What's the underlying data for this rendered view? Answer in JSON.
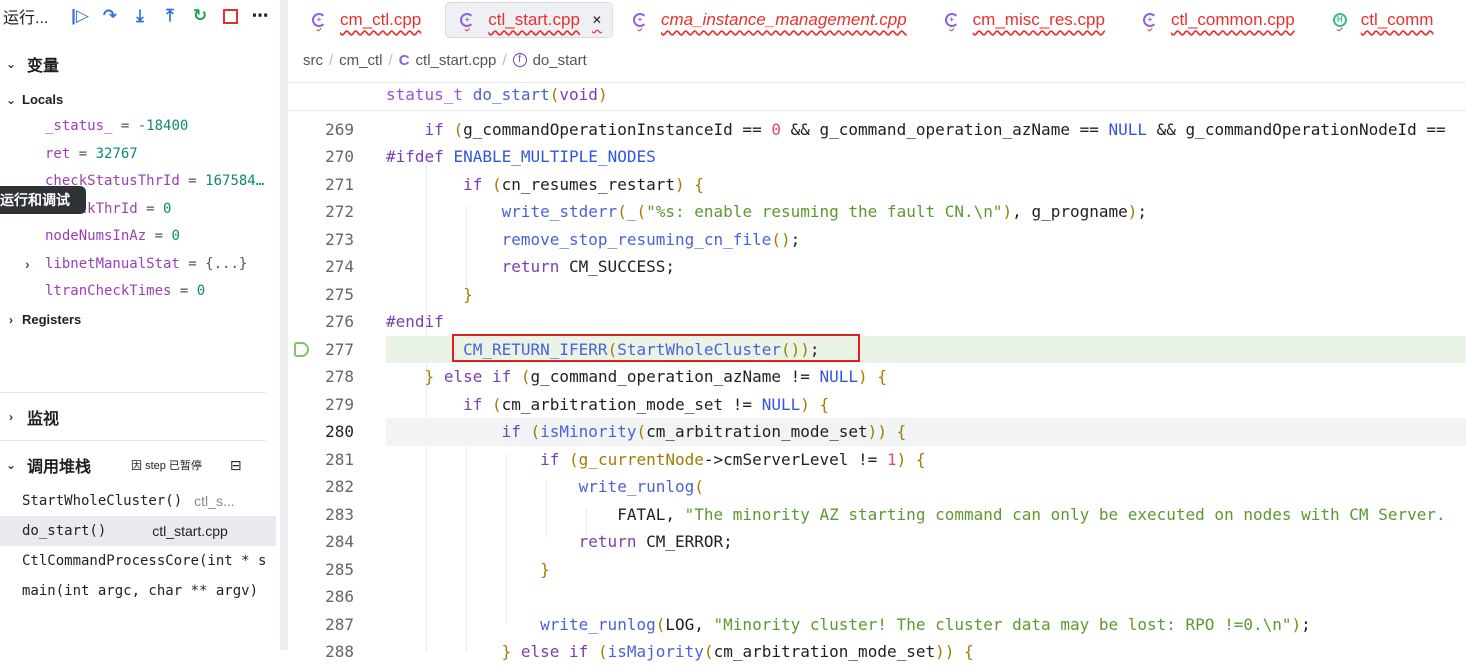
{
  "sidebar": {
    "title": "运行...",
    "toolbar_icons": [
      "continue-icon",
      "step-over-icon",
      "step-into-icon",
      "step-out-icon",
      "restart-icon",
      "stop-icon",
      "more-icon"
    ],
    "variables_label": "变量",
    "locals_label": "Locals",
    "locals": [
      {
        "name": "_status_",
        "value": "-18400"
      },
      {
        "name": "ret",
        "value": "32767"
      },
      {
        "name": "checkStatusThrId",
        "value": "167584…"
      },
      {
        "name": "…CheckThrId",
        "value": "0"
      },
      {
        "name": "nodeNumsInAz",
        "value": "0"
      },
      {
        "name": "libnetManualStat",
        "value": "{...}",
        "expandable": true
      },
      {
        "name": "ltranCheckTimes",
        "value": "0"
      }
    ],
    "registers_label": "Registers",
    "watch_label": "监视",
    "callstack_label": "调用堆栈",
    "callstack_status": "因 step 已暂停",
    "callstack": [
      {
        "func": "StartWholeCluster()",
        "file": "ctl_s..."
      },
      {
        "func": "do_start()",
        "file": "ctl_start.cpp",
        "selected": true
      },
      {
        "func": "CtlCommandProcessCore(int * s",
        "file": ""
      },
      {
        "func": "main(int argc, char ** argv)",
        "file": ""
      }
    ],
    "tooltip": "运行和调试"
  },
  "tabs": [
    {
      "label": "cm_ctl.cpp",
      "icon": "cpp-file-icon"
    },
    {
      "label": "ctl_start.cpp",
      "icon": "cpp-file-icon",
      "active": true
    },
    {
      "label": "cma_instance_management.cpp",
      "icon": "cpp-file-icon",
      "italic": true
    },
    {
      "label": "cm_misc_res.cpp",
      "icon": "cpp-file-icon"
    },
    {
      "label": "ctl_common.cpp",
      "icon": "cpp-file-icon"
    },
    {
      "label": "ctl_comm",
      "icon": "header-file-icon"
    }
  ],
  "breadcrumb": [
    "src",
    "cm_ctl",
    "ctl_start.cpp",
    "do_start"
  ],
  "sticky_header": [
    [
      "status_t",
      "ty"
    ],
    [
      " "
    ],
    [
      "do_start",
      "fn"
    ],
    [
      "(",
      "br"
    ],
    [
      "void",
      "kw"
    ],
    [
      ")",
      "br"
    ]
  ],
  "code": [
    {
      "n": "269",
      "tokens": [
        [
          "    "
        ],
        [
          "if",
          "kw"
        ],
        [
          " "
        ],
        [
          "(",
          "br"
        ],
        [
          "g_commandOperationInstanceId == "
        ],
        [
          "0",
          "num"
        ],
        [
          " && g_command_operation_azName == "
        ],
        [
          "NULL",
          "mac"
        ],
        [
          " && g_commandOperationNodeId == "
        ]
      ]
    },
    {
      "n": "270",
      "tokens": [
        [
          "#ifdef",
          "pp"
        ],
        [
          " "
        ],
        [
          "ENABLE_MULTIPLE_NODES",
          "mac"
        ]
      ]
    },
    {
      "n": "271",
      "tokens": [
        [
          "        "
        ],
        [
          "if",
          "kw"
        ],
        [
          " "
        ],
        [
          "(",
          "br"
        ],
        [
          "cn_resumes_restart"
        ],
        [
          ")",
          "br"
        ],
        [
          " "
        ],
        [
          "{",
          "br"
        ]
      ]
    },
    {
      "n": "272",
      "tokens": [
        [
          "            "
        ],
        [
          "write_stderr",
          "fn"
        ],
        [
          "(",
          "br"
        ],
        [
          "_",
          "fn"
        ],
        [
          "(",
          "br"
        ],
        [
          "\"%s: enable resuming the fault CN.\\n\"",
          "str"
        ],
        [
          ")",
          "br"
        ],
        [
          ", g_progname"
        ],
        [
          ")",
          "br"
        ],
        [
          ";"
        ]
      ]
    },
    {
      "n": "273",
      "tokens": [
        [
          "            "
        ],
        [
          "remove_stop_resuming_cn_file",
          "fn"
        ],
        [
          "()",
          "br"
        ],
        [
          ";"
        ]
      ]
    },
    {
      "n": "274",
      "tokens": [
        [
          "            "
        ],
        [
          "return",
          "kw"
        ],
        [
          " CM_SUCCESS;"
        ]
      ]
    },
    {
      "n": "275",
      "tokens": [
        [
          "        "
        ],
        [
          "}",
          "br"
        ]
      ]
    },
    {
      "n": "276",
      "tokens": [
        [
          "#endif",
          "pp"
        ]
      ]
    },
    {
      "n": "277",
      "tokens": [
        [
          "        "
        ],
        [
          "CM_RETURN_IFERR",
          "fn"
        ],
        [
          "(",
          "br"
        ],
        [
          "StartWholeCluster",
          "fn"
        ],
        [
          "()",
          "br"
        ],
        [
          ")",
          "br"
        ],
        [
          ";"
        ]
      ]
    },
    {
      "n": "278",
      "tokens": [
        [
          "    "
        ],
        [
          "}",
          "br"
        ],
        [
          " "
        ],
        [
          "else",
          "kw"
        ],
        [
          " "
        ],
        [
          "if",
          "kw"
        ],
        [
          " "
        ],
        [
          "(",
          "br"
        ],
        [
          "g_command_operation_azName != "
        ],
        [
          "NULL",
          "mac"
        ],
        [
          ")",
          "br"
        ],
        [
          " "
        ],
        [
          "{",
          "br"
        ]
      ]
    },
    {
      "n": "279",
      "tokens": [
        [
          "        "
        ],
        [
          "if",
          "kw"
        ],
        [
          " "
        ],
        [
          "(",
          "br"
        ],
        [
          "cm_arbitration_mode_set != "
        ],
        [
          "NULL",
          "mac"
        ],
        [
          ")",
          "br"
        ],
        [
          " "
        ],
        [
          "{",
          "br"
        ]
      ]
    },
    {
      "n": "280",
      "tokens": [
        [
          "            "
        ],
        [
          "if",
          "kw"
        ],
        [
          " "
        ],
        [
          "(",
          "br"
        ],
        [
          "isMinority",
          "fn"
        ],
        [
          "(",
          "br"
        ],
        [
          "cm_arbitration_mode_set"
        ],
        [
          ")",
          "br"
        ],
        [
          ")",
          "br"
        ],
        [
          " "
        ],
        [
          "{",
          "br"
        ]
      ]
    },
    {
      "n": "281",
      "tokens": [
        [
          "                "
        ],
        [
          "if",
          "kw"
        ],
        [
          " "
        ],
        [
          "(",
          "br"
        ],
        [
          "g_currentNode",
          "gv"
        ],
        [
          "->cmServerLevel != "
        ],
        [
          "1",
          "num"
        ],
        [
          ")",
          "br"
        ],
        [
          " "
        ],
        [
          "{",
          "br"
        ]
      ]
    },
    {
      "n": "282",
      "tokens": [
        [
          "                    "
        ],
        [
          "write_runlog",
          "fn"
        ],
        [
          "(",
          "br"
        ]
      ]
    },
    {
      "n": "283",
      "tokens": [
        [
          "                        FATAL, "
        ],
        [
          "\"The minority AZ starting command can only be executed on nodes with CM Server.",
          "str"
        ]
      ]
    },
    {
      "n": "284",
      "tokens": [
        [
          "                    "
        ],
        [
          "return",
          "kw"
        ],
        [
          " CM_ERROR;"
        ]
      ]
    },
    {
      "n": "285",
      "tokens": [
        [
          "                "
        ],
        [
          "}",
          "br"
        ]
      ]
    },
    {
      "n": "286",
      "tokens": [
        [
          ""
        ]
      ]
    },
    {
      "n": "287",
      "tokens": [
        [
          "                "
        ],
        [
          "write_runlog",
          "fn"
        ],
        [
          "(",
          "br"
        ],
        [
          "LOG, "
        ],
        [
          "\"Minority cluster! The cluster data may be lost: RPO !=0.\\n\"",
          "str"
        ],
        [
          ")",
          "br"
        ],
        [
          ";"
        ]
      ]
    },
    {
      "n": "288",
      "tokens": [
        [
          "            "
        ],
        [
          "}",
          "br"
        ],
        [
          " "
        ],
        [
          "else",
          "kw"
        ],
        [
          " "
        ],
        [
          "if",
          "kw"
        ],
        [
          " "
        ],
        [
          "(",
          "br"
        ],
        [
          "isMajority",
          "fn"
        ],
        [
          "(",
          "br"
        ],
        [
          "cm_arbitration_mode_set"
        ],
        [
          ")",
          "br"
        ],
        [
          ")",
          "br"
        ],
        [
          " "
        ],
        [
          "{",
          "br"
        ]
      ]
    }
  ],
  "current_line": "277",
  "cursor_line": "280",
  "colors": {
    "error_tab": "#e8312f",
    "highlight_box": "#e0201c",
    "current_line_bg": "#e9f4e7"
  }
}
